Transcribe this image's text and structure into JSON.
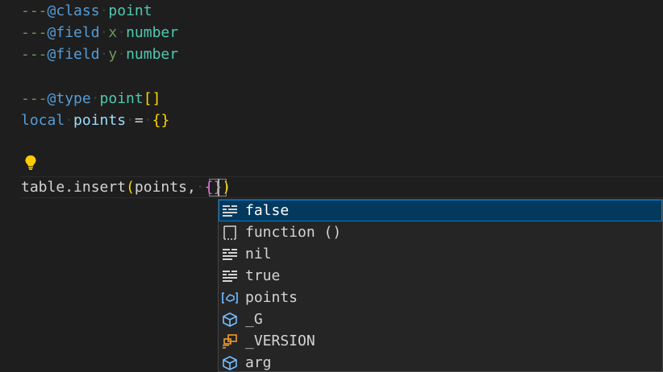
{
  "editor": {
    "lines": [
      {
        "comment_prefix": "---",
        "tag": "@class",
        "rest_type": "point"
      },
      {
        "comment_prefix": "---",
        "tag": "@field",
        "field_name": "x",
        "rest_type": "number"
      },
      {
        "comment_prefix": "---",
        "tag": "@field",
        "field_name": "y",
        "rest_type": "number"
      },
      {
        "comment_prefix": "---",
        "tag": "@type",
        "rest_type": "point",
        "suffix": "[]"
      }
    ],
    "local_line": {
      "keyword": "local",
      "name": "points",
      "op": "=",
      "open_brace": "{",
      "close_brace": "}"
    },
    "current_line": {
      "object": "table",
      "dot": ".",
      "method": "insert",
      "open_paren": "(",
      "arg1": "points",
      "comma": ",",
      "open_brace": "{",
      "close_brace": "}",
      "close_paren": ")"
    }
  },
  "suggestions": {
    "items": [
      {
        "label": "false",
        "icon": "keyword-icon",
        "selected": true
      },
      {
        "label": "function ()",
        "icon": "snippet-icon",
        "selected": false
      },
      {
        "label": "nil",
        "icon": "keyword-icon",
        "selected": false
      },
      {
        "label": "true",
        "icon": "keyword-icon",
        "selected": false
      },
      {
        "label": "points",
        "icon": "variable-icon",
        "selected": false
      },
      {
        "label": "_G",
        "icon": "module-icon",
        "selected": false
      },
      {
        "label": "_VERSION",
        "icon": "field-icon",
        "selected": false
      },
      {
        "label": "arg",
        "icon": "module-icon",
        "selected": false
      }
    ]
  },
  "colors": {
    "background": "#1e1e1e",
    "comment": "#6a9955",
    "tag": "#569cd6",
    "type": "#4ec9b0",
    "variable": "#9cdcfe",
    "brace": "#ffd700",
    "selection": "#04395e"
  }
}
